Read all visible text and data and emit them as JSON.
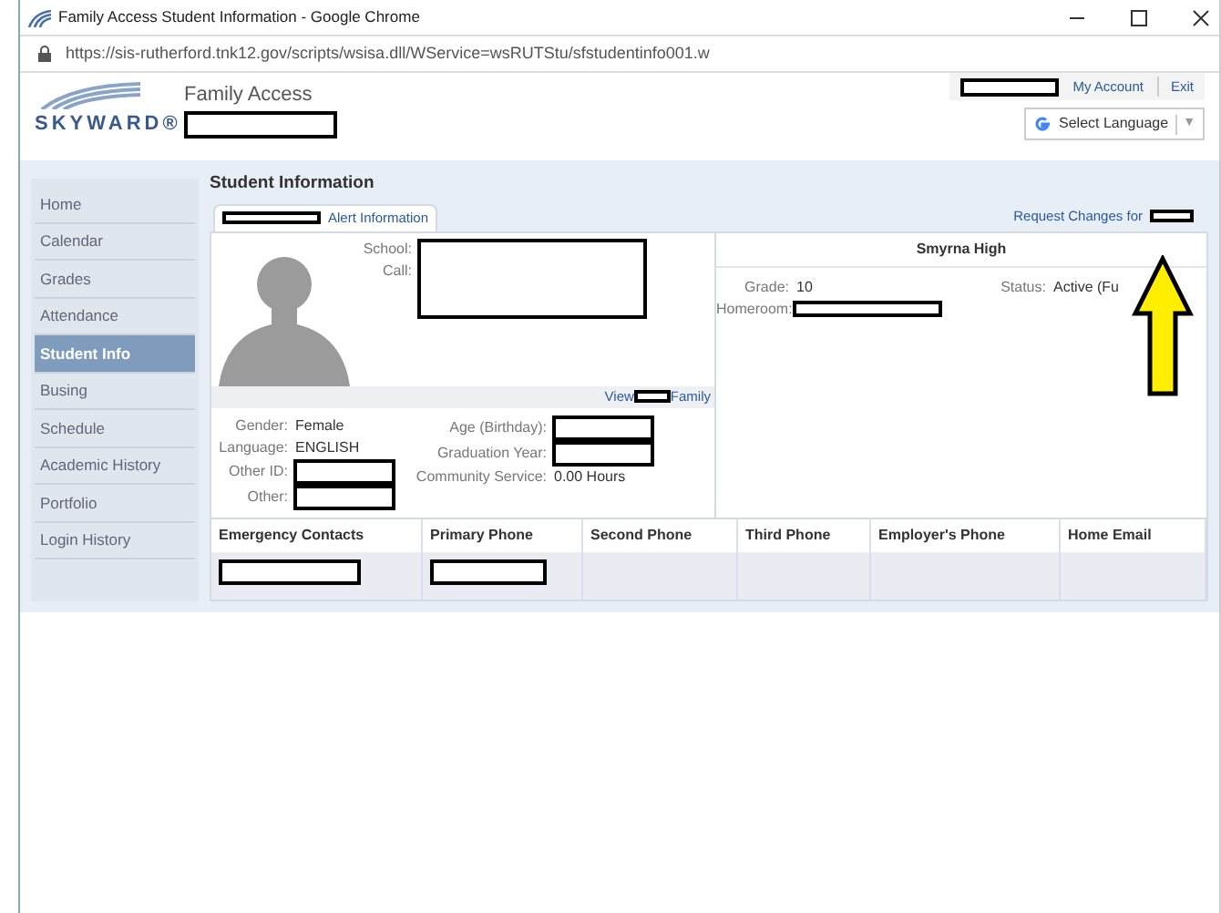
{
  "window": {
    "title": "Family Access Student Information - Google Chrome"
  },
  "address_bar": {
    "url": "https://sis-rutherford.tnk12.gov/scripts/wsisa.dll/WService=wsRUTStu/sfstudentinfo001.w"
  },
  "header": {
    "logo": "SKYWARD®",
    "app_name": "Family Access",
    "user_redacted": true,
    "account_redacted": true,
    "links": [
      "My Account",
      "Exit"
    ],
    "language": "Select Language",
    "language_caret": "▼"
  },
  "sidebar": {
    "items": [
      {
        "label": "Home",
        "selected": false
      },
      {
        "label": "Calendar",
        "selected": false
      },
      {
        "label": "Grades",
        "selected": false
      },
      {
        "label": "Attendance",
        "selected": false
      },
      {
        "label": "Student Info",
        "selected": true
      },
      {
        "label": "Busing",
        "selected": false
      },
      {
        "label": "Schedule",
        "selected": false
      },
      {
        "label": "Academic History",
        "selected": false
      },
      {
        "label": "Portfolio",
        "selected": false
      },
      {
        "label": "Login History",
        "selected": false
      }
    ]
  },
  "content": {
    "title": "Student Information",
    "tab": {
      "label": "Alert Information",
      "redacted": true
    },
    "request_link": {
      "label": "Request Changes for",
      "redacted": true
    },
    "photo_fields": [
      {
        "label": "School:",
        "redacted": true
      },
      {
        "label": "Call:",
        "redacted": true
      }
    ],
    "view_link": {
      "before": "View",
      "after": "Family",
      "redacted": true
    },
    "details_left": [
      {
        "label": "Gender:",
        "value": "Female"
      },
      {
        "label": "Language:",
        "value": "ENGLISH"
      },
      {
        "label": "Other ID:",
        "redacted": true
      },
      {
        "label": "Other:",
        "redacted": true
      }
    ],
    "details_right": [
      {
        "label": "Age (Birthday):",
        "redacted": true
      },
      {
        "label": "Graduation Year:",
        "redacted": true
      },
      {
        "label": "Community Service:",
        "value": "0.00 Hours"
      }
    ],
    "school": {
      "name": "Smyrna High",
      "grade_label": "Grade:",
      "grade": "10",
      "status_label": "Status:",
      "status": "Active (Fu",
      "homeroom_label": "Homeroom:",
      "homeroom_redacted": true
    },
    "table": {
      "columns": [
        "Emergency Contacts",
        "Primary Phone",
        "Second Phone",
        "Third Phone",
        "Employer's Phone",
        "Home Email"
      ],
      "rows": [
        [
          {
            "redacted": true
          },
          {
            "redacted": true
          },
          {},
          {},
          {},
          {}
        ]
      ]
    }
  }
}
